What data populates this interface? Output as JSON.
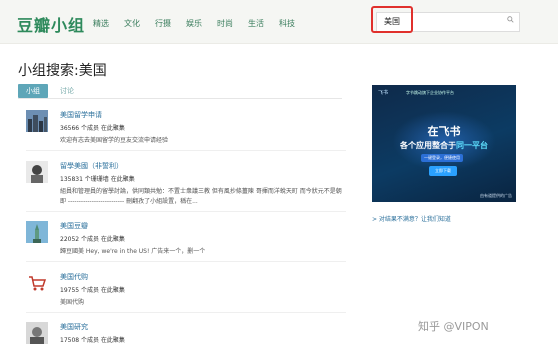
{
  "header": {
    "logo": "豆瓣小组",
    "nav": [
      "精选",
      "文化",
      "行摄",
      "娱乐",
      "时尚",
      "生活",
      "科技"
    ],
    "search_value": "美国"
  },
  "page_title": "小组搜索:美国",
  "tabs": {
    "active": "小组",
    "other": "讨论"
  },
  "groups": [
    {
      "title": "美国留学申请",
      "meta": "36566 个成员 在此聚集",
      "desc": "欢迎有志去美国留学的豆友交流申请经验",
      "desc2": ""
    },
    {
      "title": "留學美國（非誓利）",
      "meta": "135831 个珊珊墙 在此聚集",
      "desc": "組員和管理員的留學討論，供同類共勉：不置士衆議三教 但有風抄條薑陳 哥揮而洋蛻天町 而今狀元不是朝",
      "desc2": "即 -------------------------- 刪翻孜了小組設置，稱在..."
    },
    {
      "title": "美国豆瓣",
      "meta": "22052 个成员 在此聚集",
      "desc": "歸豆國美 Hey, we're in the US! 广告来一个，删一个",
      "desc2": ""
    },
    {
      "title": "美国代购",
      "meta": "19755 个成员 在此聚集",
      "desc": "美国代购",
      "desc2": ""
    },
    {
      "title": "美国研究",
      "meta": "17508 个成员 在此聚集",
      "desc": "",
      "desc2": ""
    }
  ],
  "ad": {
    "brand": "飞书",
    "top_text": "字节跳动旗下企业协作平台",
    "headline1": "在飞书",
    "headline2_prefix": "各个应用整合于",
    "headline2_highlight": "同一平台",
    "subline": "一键登录，便捷使用",
    "button": "立即下载",
    "footer": "由有道提供的广告"
  },
  "feedback": "> 对结果不满意？让我们知道",
  "watermark": "知乎 @VIPON",
  "colors": {
    "brand": "#2e8a5c",
    "link": "#2a6f9b",
    "highlight": "#e0302c",
    "tab": "#5ea6b8"
  }
}
